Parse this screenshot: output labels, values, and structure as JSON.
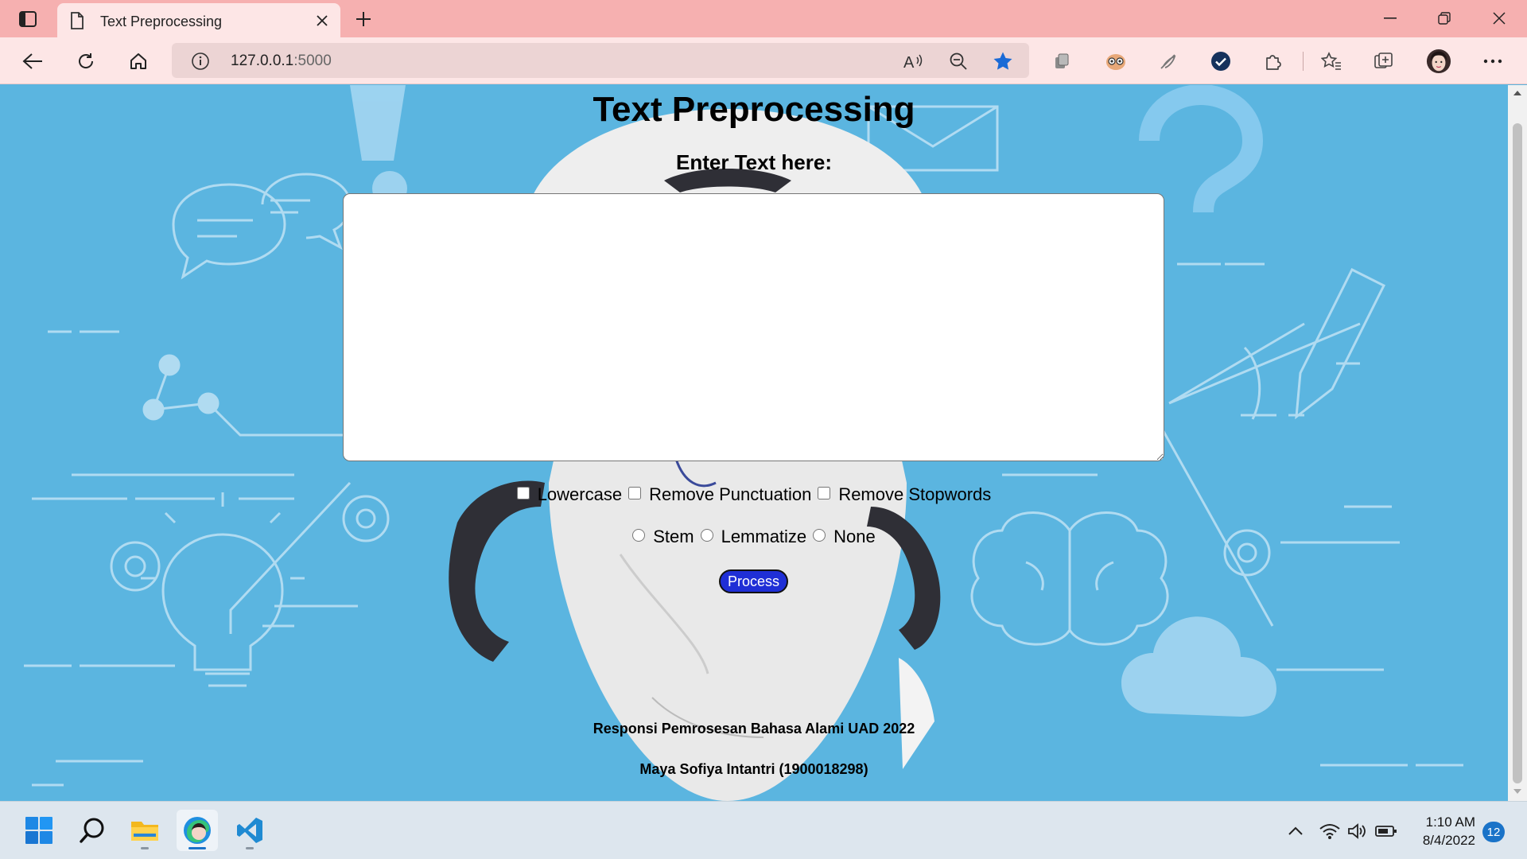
{
  "browser": {
    "tab": {
      "title": "Text Preprocessing",
      "icon": "page-icon"
    },
    "address": {
      "host": "127.0.0.1",
      "port": ":5000"
    }
  },
  "page": {
    "title": "Text Preprocessing",
    "input_label": "Enter Text here:",
    "textarea_value": "",
    "checkboxes": [
      "Lowercase",
      "Remove Punctuation",
      "Remove Stopwords"
    ],
    "radios": [
      "Stem",
      "Lemmatize",
      "None"
    ],
    "process_button": "Process",
    "footer_line1": "Responsi Pemrosesan Bahasa Alami UAD 2022",
    "footer_line2": "Maya Sofiya Intantri (1900018298)"
  },
  "taskbar": {
    "apps": [
      "windows-start-icon",
      "search-icon",
      "file-explorer-icon",
      "edge-icon",
      "vscode-icon"
    ],
    "clock_time": "1:10 AM",
    "clock_date": "8/4/2022",
    "notifications": "12"
  },
  "colors": {
    "chrome_pink": "#f6b0b0",
    "page_background": "#5bb5e0",
    "process_button": "#1f2fd6",
    "favorite_star": "#1a6ad6"
  }
}
